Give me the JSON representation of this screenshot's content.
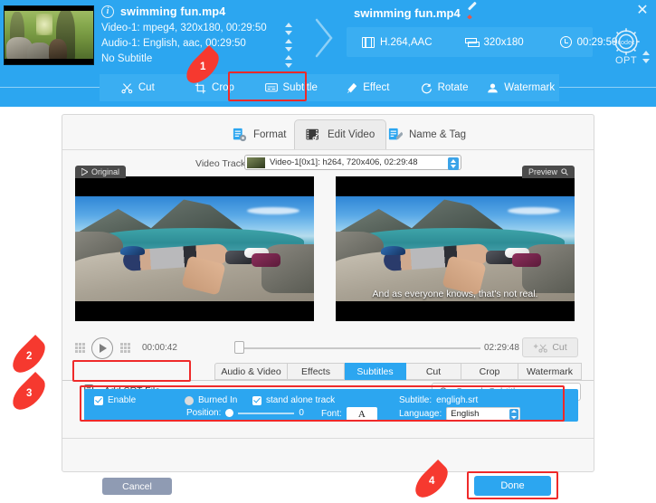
{
  "header": {
    "file_name": "swimming fun.mp4",
    "info_icon": "info-icon",
    "streams": [
      "Video-1: mpeg4, 320x180, 00:29:50",
      "Audio-1: English, aac, 00:29:50",
      "No Subtitle"
    ],
    "right_title": "swimming fun.mp4",
    "codec_chips": [
      {
        "icon": "film-icon",
        "label": "H.264,AAC"
      },
      {
        "icon": "resolution-icon",
        "label": "320x180"
      },
      {
        "icon": "clock-icon",
        "label": "00:29:50"
      }
    ],
    "codec_opt": {
      "gear_text": "codec",
      "label": "OPT"
    },
    "close_label": "✕"
  },
  "toolbar": {
    "items": [
      {
        "label": "Cut",
        "icon": "scissors-icon",
        "active": false
      },
      {
        "label": "Crop",
        "icon": "crop-icon",
        "active": false
      },
      {
        "label": "Subtitle",
        "icon": "subtitle-icon",
        "active": true
      },
      {
        "label": "Effect",
        "icon": "effect-icon",
        "active": false
      },
      {
        "label": "Rotate",
        "icon": "rotate-icon",
        "active": false
      },
      {
        "label": "Watermark",
        "icon": "watermark-icon",
        "active": false
      }
    ]
  },
  "panel": {
    "tabs": [
      {
        "label": "Format",
        "icon": "format-icon",
        "selected": false
      },
      {
        "label": "Edit Video",
        "icon": "editvideo-icon",
        "selected": true
      },
      {
        "label": "Name & Tag",
        "icon": "nametag-icon",
        "selected": false
      }
    ],
    "video_track": {
      "label": "Video Track:",
      "value": "Video-1[0x1]: h264, 720x406, 02:29:48"
    },
    "preview": {
      "left_tag": "Original",
      "right_tag": "Preview",
      "subtitle_text": "And as everyone knows, that's not real."
    },
    "player": {
      "current_time": "00:00:42",
      "total_time": "02:29:48",
      "cut_label": "Cut",
      "play_icon": "play-icon"
    },
    "sub_tabs": [
      {
        "label": "Audio & Video",
        "active": false
      },
      {
        "label": "Effects",
        "active": false
      },
      {
        "label": "Subtitles",
        "active": true
      },
      {
        "label": "Cut",
        "active": false
      },
      {
        "label": "Crop",
        "active": false
      },
      {
        "label": "Watermark",
        "active": false
      }
    ],
    "srt_row": {
      "add_label": "Add SRT File...",
      "add_icon": "add-file-icon",
      "search_placeholder": "Search Subtitle",
      "search_icon": "search-icon"
    },
    "settings": {
      "enable_label": "Enable",
      "enable_checked": true,
      "burned_label": "Burned In",
      "burned_checked": false,
      "standalone_label": "stand alone track",
      "standalone_checked": true,
      "subtitle_label": "Subtitle:",
      "subtitle_value": "engligh.srt",
      "position_label": "Position:",
      "position_value": "0",
      "font_label": "Font:",
      "font_glyph": "A",
      "language_label": "Language:",
      "language_value": "English"
    },
    "footer": {
      "cancel_label": "Cancel",
      "done_label": "Done"
    }
  },
  "annotations": {
    "markers": [
      "1",
      "2",
      "3",
      "4"
    ],
    "accent_red": "#ef2a2a",
    "accent_blue": "#2ca6f0"
  }
}
